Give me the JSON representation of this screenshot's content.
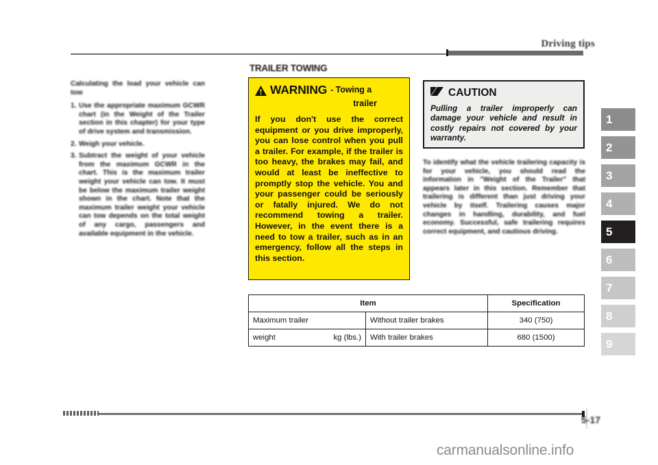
{
  "header": {
    "title": "Driving tips"
  },
  "sidebar": {
    "tabs": [
      {
        "label": "1",
        "color": "#8c8c8c",
        "active": false
      },
      {
        "label": "2",
        "color": "#949494",
        "active": false
      },
      {
        "label": "3",
        "color": "#a3a3a3",
        "active": false
      },
      {
        "label": "4",
        "color": "#b0b0b0",
        "active": false
      },
      {
        "label": "5",
        "color": "#231f20",
        "active": true
      },
      {
        "label": "6",
        "color": "#bdbdbd",
        "active": false
      },
      {
        "label": "7",
        "color": "#c6c6c6",
        "active": false
      },
      {
        "label": "8",
        "color": "#cfcfcf",
        "active": false
      },
      {
        "label": "9",
        "color": "#d6d6d6",
        "active": false
      }
    ]
  },
  "left_column": {
    "heading": "Calculating the load your vehicle can tow",
    "items": [
      {
        "num": "1.",
        "text": "Use the appropriate maximum GCWR chart (in the Weight of the Trailer section in this chapter) for your type of drive system and transmission."
      },
      {
        "num": "2.",
        "text": "Weigh your vehicle."
      },
      {
        "num": "3.",
        "text": "Subtract the weight of your vehicle from the maximum GCWR in the chart. This is the maximum trailer weight your vehicle can tow. It must be below the maximum trailer weight shown in the chart. Note that the maximum trailer weight your vehicle can tow depends on the total weight of any cargo, passengers and available equipment in the vehicle."
      }
    ]
  },
  "section": {
    "title": "TRAILER TOWING"
  },
  "warning": {
    "icon": "warning-triangle-icon",
    "word": "WARNING",
    "subtitle_line1": "- Towing a",
    "subtitle_line2": "trailer",
    "body": "If you don't use the correct equipment or you drive improperly, you can lose control when you pull a trailer. For example, if the trailer is too heavy, the brakes may fail, and would at least be ineffective to promptly stop the vehicle. You and your passenger could be seriously or fatally injured. We do not recommend towing a trailer. However, in the event there is a need to tow a trailer, such as in an emergency, follow all the steps in this section.",
    "background_color": "#ffe800"
  },
  "caution": {
    "icon": "caution-slash-icon",
    "word": "CAUTION",
    "body": "Pulling a trailer improperly can damage your vehicle and result in costly repairs not covered by your warranty.",
    "background_color": "#eeeeec"
  },
  "right_column": {
    "paragraph": "To identify what the vehicle trailering capacity is for your vehicle, you should read the information in \"Weight of the Trailer\" that appears later in this section. Remember that trailering is different than just driving your vehicle by itself. Trailering causes major changes in handling, durability, and fuel economy. Successful, safe trailering requires correct equipment, and cautious driving."
  },
  "spec_table": {
    "headers": [
      "Item",
      "Specification"
    ],
    "rows": [
      {
        "item_main": "Maximum trailer",
        "item_unit": "",
        "item_sub": "Without trailer brakes",
        "spec": "340 (750)"
      },
      {
        "item_main": "weight",
        "item_unit": "kg (lbs.)",
        "item_sub": "With trailer brakes",
        "spec": "680 (1500)"
      }
    ]
  },
  "footer": {
    "page_number": "5-17",
    "watermark": "carmanualsonline.info"
  }
}
